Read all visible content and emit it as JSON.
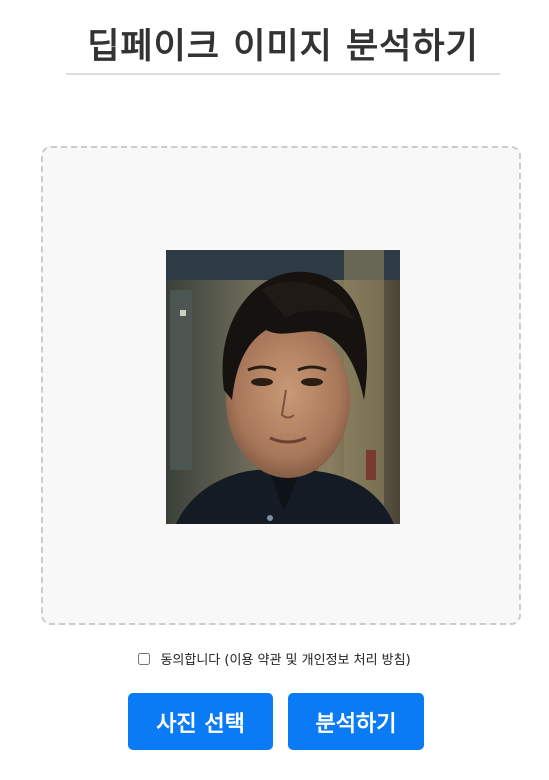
{
  "header": {
    "title": "딥페이크 이미지 분석하기"
  },
  "upload": {
    "image_alt": "업로드된 인물 사진"
  },
  "consent": {
    "label": "동의합니다 (이용 약관 및 개인정보 처리 방침)",
    "checked": false
  },
  "actions": {
    "select_photo_label": "사진 선택",
    "analyze_label": "분석하기"
  },
  "colors": {
    "primary": "#0a7bf5",
    "title": "#333333",
    "dropzone_border": "#cccccc",
    "dropzone_bg": "#f8f8f8"
  }
}
